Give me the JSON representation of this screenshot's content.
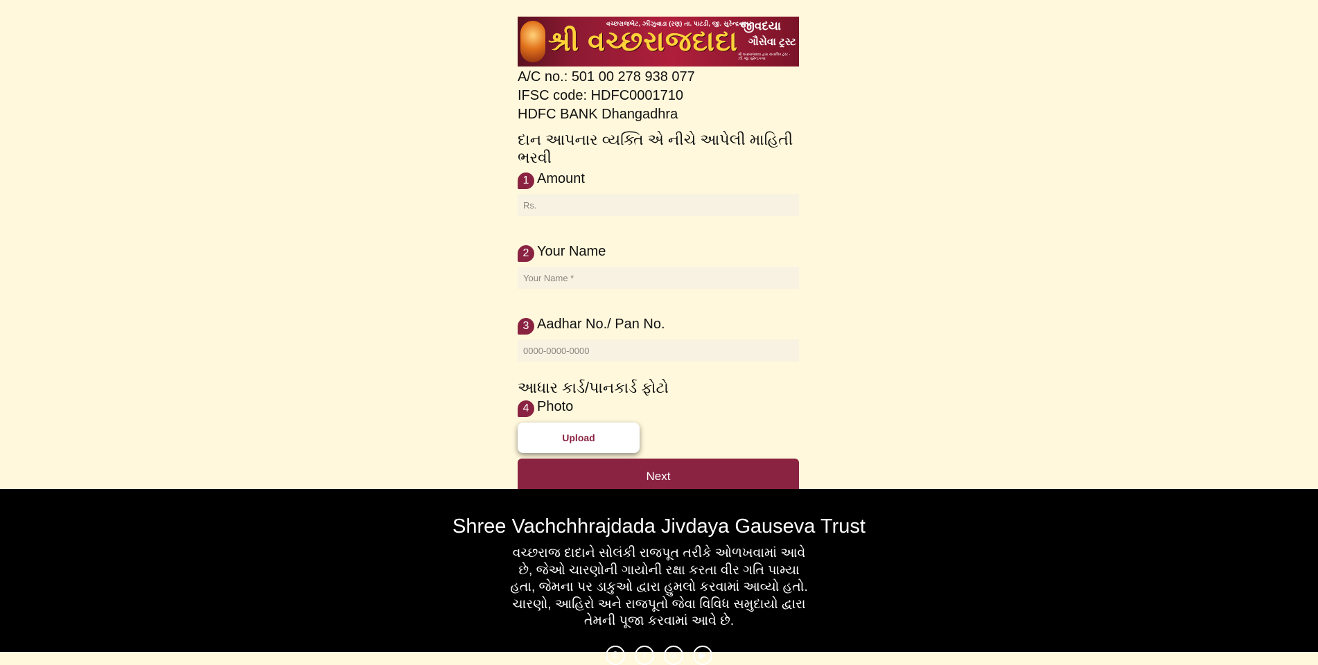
{
  "banner": {
    "top_line": "વચ્છરાજબેટ, ઝીંઝુવાડા (રણ) તા. પાટડી, જી. સુરેન્દ્રનગર.",
    "title": "શ્રી વચ્છરાજદાદા",
    "jivdaya": "જીવદયા",
    "gauseva": "ગૌસેવા ટ્રસ્ટ",
    "small_text": "શ્રી વચ્છરાજદાદા દ્વારા સંચાલિત ટ્રસ્ટ - ઝીં. જી. સુરેન્દ્રનગર"
  },
  "account": {
    "ac_no": "A/C no.: 501 00 278 938 077",
    "ifsc": "IFSC code: HDFC0001710",
    "bank": "HDFC BANK Dhangadhra"
  },
  "instruction": "દાન આપનાર વ્યક્તિ એ નીચે આપેલી માહિતી ભરવી",
  "fields": {
    "amount": {
      "num": "1",
      "label": "Amount",
      "placeholder": "Rs."
    },
    "name": {
      "num": "2",
      "label": "Your Name",
      "placeholder": "Your Name *"
    },
    "aadhar": {
      "num": "3",
      "label": "Aadhar No./ Pan No.",
      "placeholder": "0000-0000-0000"
    },
    "photo": {
      "num": "4",
      "label": "Photo"
    }
  },
  "photo_title": "આધાર કાર્ડ/પાનકાર્ડ ફોટો",
  "buttons": {
    "upload": "Upload",
    "next": "Next"
  },
  "footer": {
    "title": "Shree Vachchhrajdada Jivdaya Gauseva Trust",
    "description": "વચ્છરાજ દાદાને સોલંકી રાજપૂત તરીકે ઓળખવામાં આવે છે, જેઓ ચારણોની ગાયોની રક્ષા કરતા વીર ગતિ પામ્યા હતા, જેમના પર ડાકુઓ દ્વારા હુમલો કરવામાં આવ્યો હતો. ચારણો, આહિરો અને રાજપૂતો જેવા વિવિધ સમુદાયો દ્વારા તેમની પૂજા કરવામાં આવે છે."
  },
  "social_icons": [
    "whatsapp-icon",
    "facebook-icon",
    "instagram-icon",
    "youtube-icon"
  ]
}
